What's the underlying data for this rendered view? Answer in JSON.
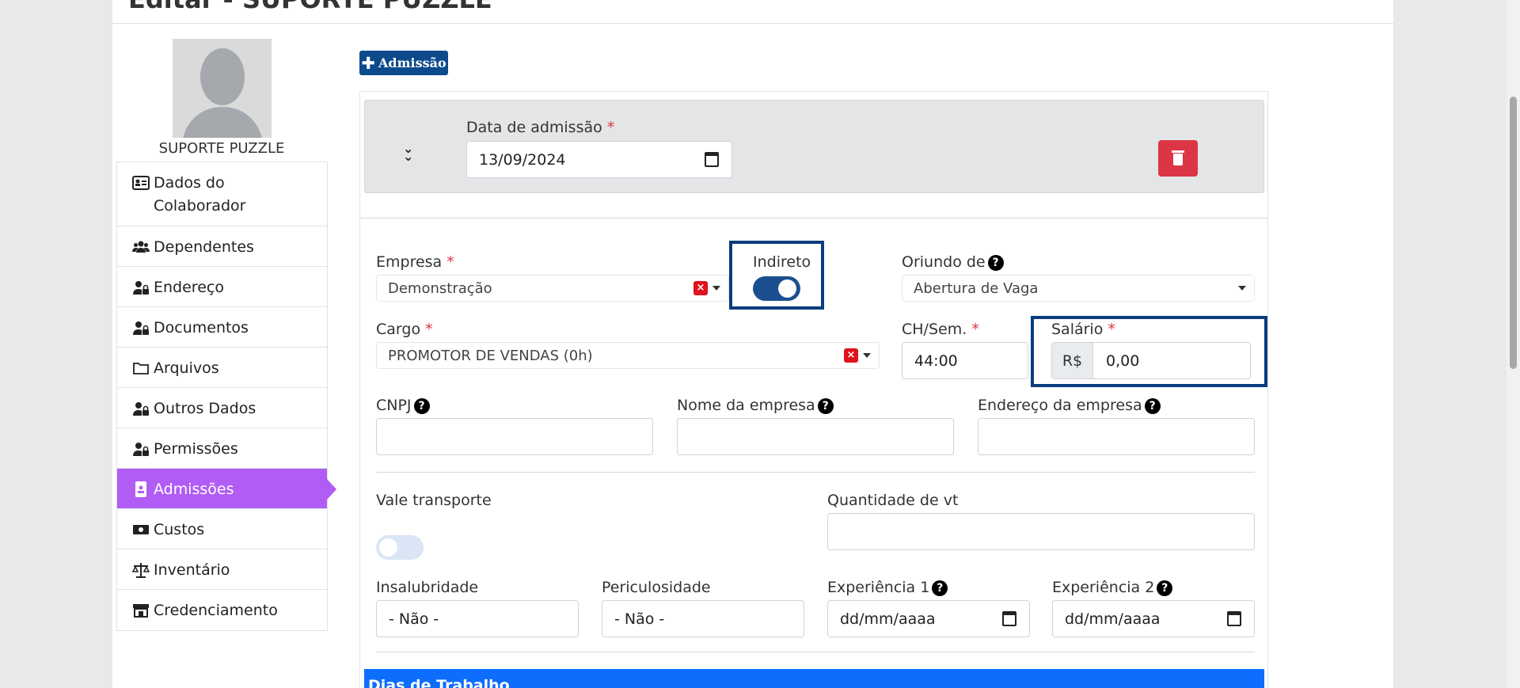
{
  "page": {
    "title": "Editar - SUPORTE PUZZLE"
  },
  "profile": {
    "name": "SUPORTE PUZZLE"
  },
  "sidebar": {
    "items": [
      {
        "label": "Dados do Colaborador",
        "icon": "id-card-icon"
      },
      {
        "label": "Dependentes",
        "icon": "users-icon"
      },
      {
        "label": "Endereço",
        "icon": "user-lock-icon"
      },
      {
        "label": "Documentos",
        "icon": "user-lock-icon"
      },
      {
        "label": "Arquivos",
        "icon": "folder-icon"
      },
      {
        "label": "Outros Dados",
        "icon": "user-lock-icon"
      },
      {
        "label": "Permissões",
        "icon": "user-lock-icon"
      },
      {
        "label": "Admissões",
        "icon": "id-badge-icon",
        "active": true
      },
      {
        "label": "Custos",
        "icon": "money-icon"
      },
      {
        "label": "Inventário",
        "icon": "scale-icon"
      },
      {
        "label": "Credenciamento",
        "icon": "store-icon"
      }
    ],
    "active_color": "#b05cf5"
  },
  "toolbar": {
    "add_label": "Admissão"
  },
  "admission": {
    "date_label": "Data de admissão",
    "date_value": "13/09/2024",
    "empresa_label": "Empresa",
    "empresa_value": "Demonstração",
    "indireto_label": "Indireto",
    "indireto_on": true,
    "oriundo_label": "Oriundo de",
    "oriundo_value": "Abertura de Vaga",
    "cargo_label": "Cargo",
    "cargo_value": "PROMOTOR DE VENDAS (0h)",
    "ch_label": "CH/Sem.",
    "ch_value": "44:00",
    "salario_label": "Salário",
    "salario_prefix": "R$",
    "salario_value": "0,00",
    "cnpj_label": "CNPJ",
    "nome_empresa_label": "Nome da empresa",
    "endereco_empresa_label": "Endereço da empresa",
    "vale_label": "Vale transporte",
    "vale_on": false,
    "qtd_vt_label": "Quantidade de vt",
    "insalubridade_label": "Insalubridade",
    "insalubridade_value": "- Não -",
    "periculosidade_label": "Periculosidade",
    "periculosidade_value": "- Não -",
    "exp1_label": "Experiência 1",
    "exp1_placeholder": "dd/mm/aaaa",
    "exp2_label": "Experiência 2",
    "exp2_placeholder": "dd/mm/aaaa",
    "required_mark": "*",
    "help_mark": "?",
    "clear_mark": "×"
  },
  "section": {
    "dias_label": "Dias de Trabalho"
  },
  "colors": {
    "primary": "#0d4a8c",
    "danger": "#dc3545",
    "highlight": "#0a3d7d",
    "blue_bar": "#0d6efd"
  }
}
